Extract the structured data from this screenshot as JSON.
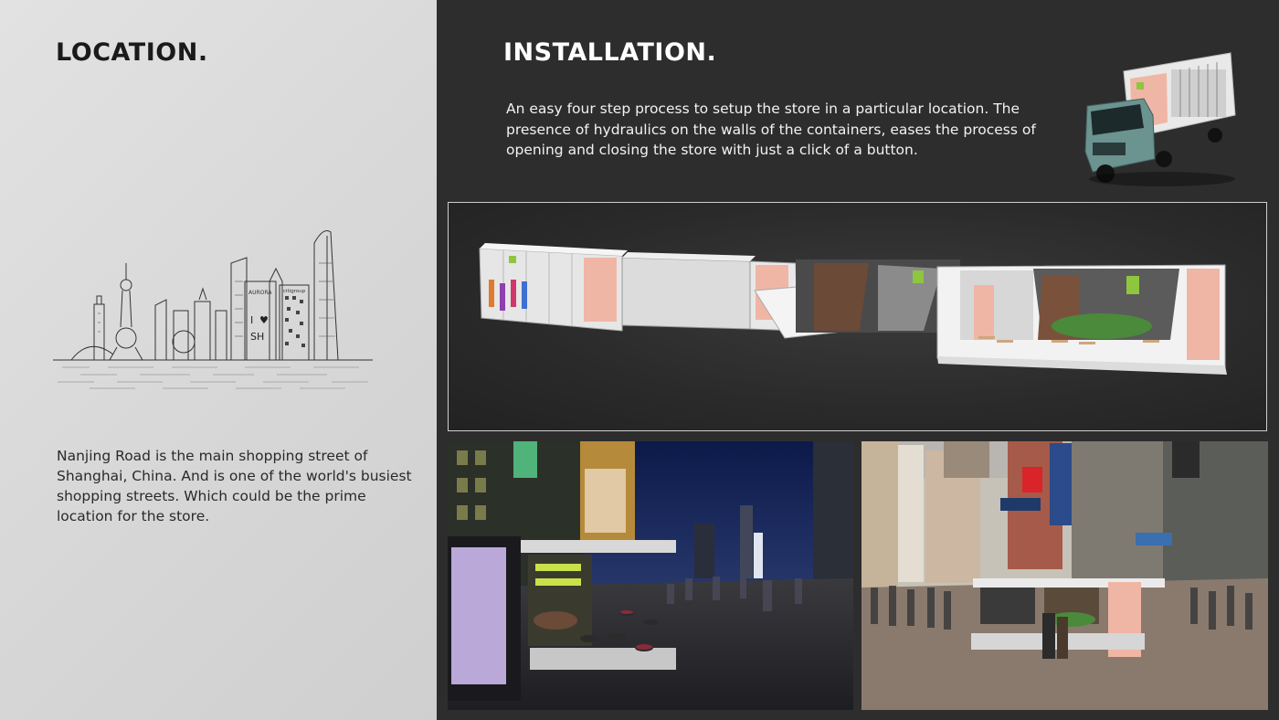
{
  "location": {
    "title": "LOCATION.",
    "skyline_signs": {
      "aurora": "AURORA",
      "citigroup": "citigroup",
      "i": "I",
      "heart": "♥",
      "sh": "SH"
    },
    "description": "Nanjing Road is the main shopping street of Shanghai, China. And is one of the world's busiest shopping streets. Which could be the prime location for the store."
  },
  "installation": {
    "title": "INSTALLATION.",
    "description": "An easy four step process to setup the store in a particular location. The presence of hydraulics on the walls of the containers, eases the process of opening and closing the store with just a click of a button."
  },
  "icons": {
    "skyline": "shanghai-skyline-illustration",
    "truck": "container-truck-image",
    "render": "container-store-render",
    "night_photo": "night-street-store-photo",
    "day_photo": "day-street-store-photo"
  },
  "colors": {
    "left_bg": "#dcdcdc",
    "right_bg": "#2d2d2d",
    "accent_green": "#8ec63f",
    "accent_pink": "#e8a08a"
  }
}
